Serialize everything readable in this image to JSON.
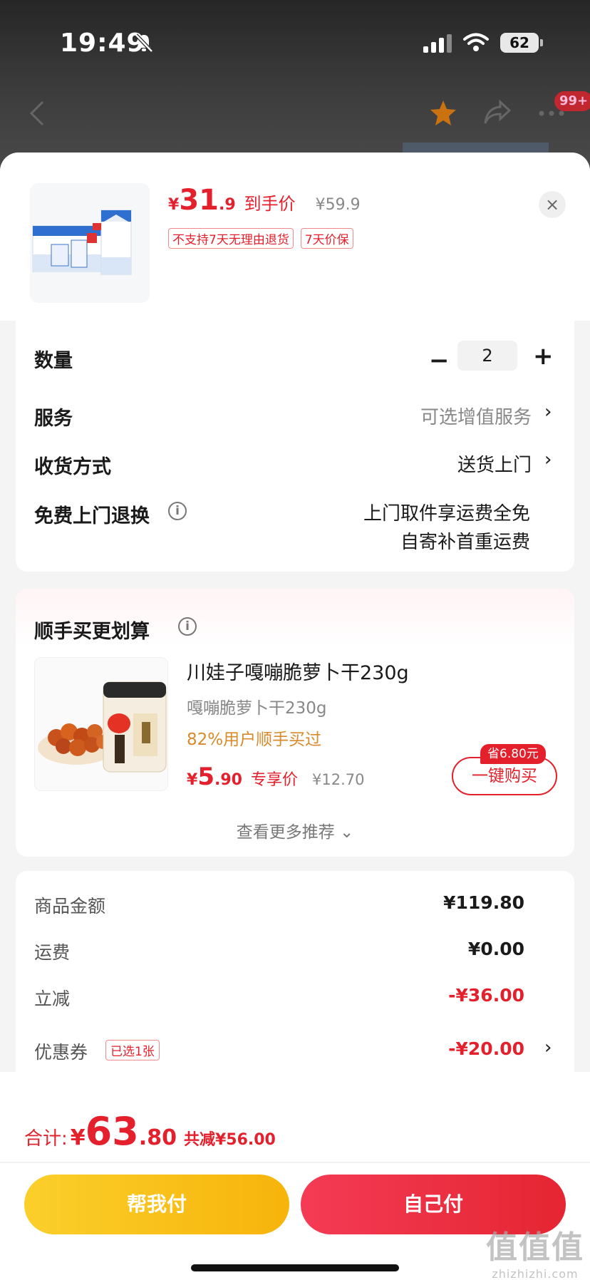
{
  "status_bar": {
    "time": "19:49",
    "battery": "62"
  },
  "nav": {
    "badge": "99+"
  },
  "product": {
    "price_yen": "¥",
    "price_int": "31",
    "price_dec": ".9",
    "price_label": "到手价",
    "original_price": "¥59.9",
    "tags": [
      "不支持7天无理由退货",
      "7天价保"
    ],
    "close": "×"
  },
  "options": {
    "quantity_label": "数量",
    "quantity_value": "2",
    "minus": "−",
    "plus": "+",
    "service_label": "服务",
    "service_value": "可选增值服务",
    "delivery_label": "收货方式",
    "delivery_value": "送货上门",
    "return_label": "免费上门退换",
    "return_line1": "上门取件享运费全免",
    "return_line2": "自寄补首重运费",
    "chevron": "›",
    "info": "i"
  },
  "recommend": {
    "title": "顺手买更划算",
    "name": "川娃子嘎嘣脆萝卜干230g",
    "spec": "嘎嘣脆萝卜干230g",
    "popularity": "82%用户顺手买过",
    "price_yen": "¥",
    "price_int": "5",
    "price_dec": ".90",
    "price_label": "专享价",
    "original_price": "¥12.70",
    "save_tag": "省6.80元",
    "buy_button": "一键购买",
    "more": "查看更多推荐 ⌄"
  },
  "summary": {
    "goods_label": "商品金额",
    "goods_value": "¥119.80",
    "shipping_label": "运费",
    "shipping_value": "¥0.00",
    "instant_label": "立减",
    "instant_value": "-¥36.00",
    "coupon_label": "优惠券",
    "coupon_tag": "已选1张",
    "coupon_value": "-¥20.00"
  },
  "footer": {
    "total_label": "合计:",
    "total_yen": "¥",
    "total_int": "63",
    "total_dec": ".80",
    "total_discount": "共减¥56.00",
    "help_pay": "帮我付",
    "self_pay": "自己付"
  },
  "watermark": {
    "big": "值值值",
    "small": "zhizhizhi.com"
  },
  "colors": {
    "accent": "#e4202c",
    "help_btn": "#f9c11c",
    "self_btn": "#ec2e42"
  }
}
